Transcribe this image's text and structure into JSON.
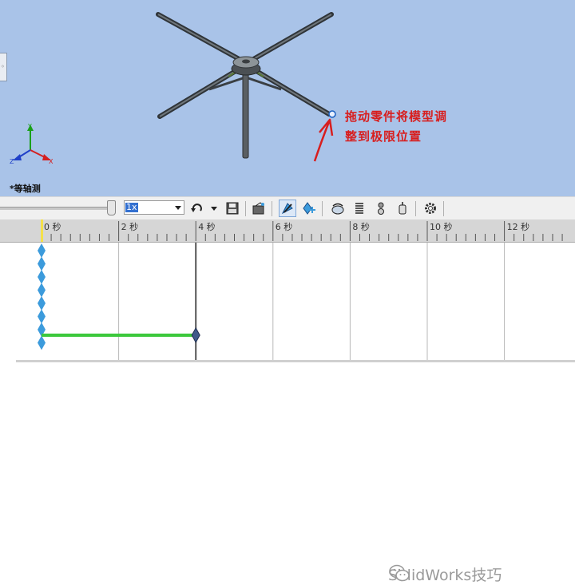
{
  "viewport": {
    "view_name": "*等轴测",
    "annotation_line1": "拖动零件将模型调",
    "annotation_line2": "整到极限位置",
    "triad": {
      "x": "X",
      "y": "Y",
      "z": "Z"
    }
  },
  "toolbar": {
    "playback_speed": "1x",
    "icons": [
      "playback-mode-icon",
      "save-animation-icon",
      "animation-wizard-icon",
      "autokey-icon",
      "add-update-key-icon",
      "motor-icon",
      "spring-icon",
      "contact-icon",
      "gravity-icon",
      "settings-icon"
    ]
  },
  "timeline": {
    "ticks": [
      "0 秒",
      "2 秒",
      "4 秒",
      "6 秒",
      "8 秒",
      "10 秒",
      "12 秒"
    ],
    "time_bar_seconds": 4,
    "key_start_seconds": 0,
    "key_end_seconds": 4,
    "colors": {
      "key": "#3c9bdc",
      "change_bar": "#3cc83c",
      "time_line": "#555555"
    }
  },
  "watermark": {
    "text": "SolidWorks技巧"
  }
}
